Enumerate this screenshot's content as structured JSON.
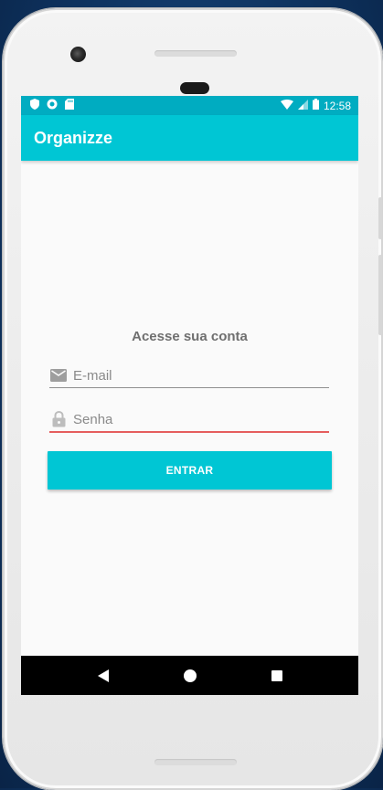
{
  "status_bar": {
    "time": "12:58",
    "left_icons": [
      "shield-icon",
      "circle-sync-icon",
      "sd-card-icon"
    ],
    "right_icons": [
      "wifi-icon",
      "signal-icon",
      "battery-icon"
    ]
  },
  "app_bar": {
    "title": "Organizze"
  },
  "login": {
    "heading": "Acesse sua conta",
    "email": {
      "placeholder": "E-mail",
      "value": "",
      "icon": "mail-icon"
    },
    "password": {
      "placeholder": "Senha",
      "value": "",
      "icon": "lock-icon"
    },
    "submit_label": "ENTRAR"
  },
  "nav_bar": {
    "buttons": [
      "back-icon",
      "home-icon",
      "recents-icon"
    ]
  },
  "colors": {
    "primary": "#00c6d4",
    "primary_dark": "#00acc1",
    "error_underline": "#e55d5d",
    "heading_text": "#6f6f6f"
  }
}
